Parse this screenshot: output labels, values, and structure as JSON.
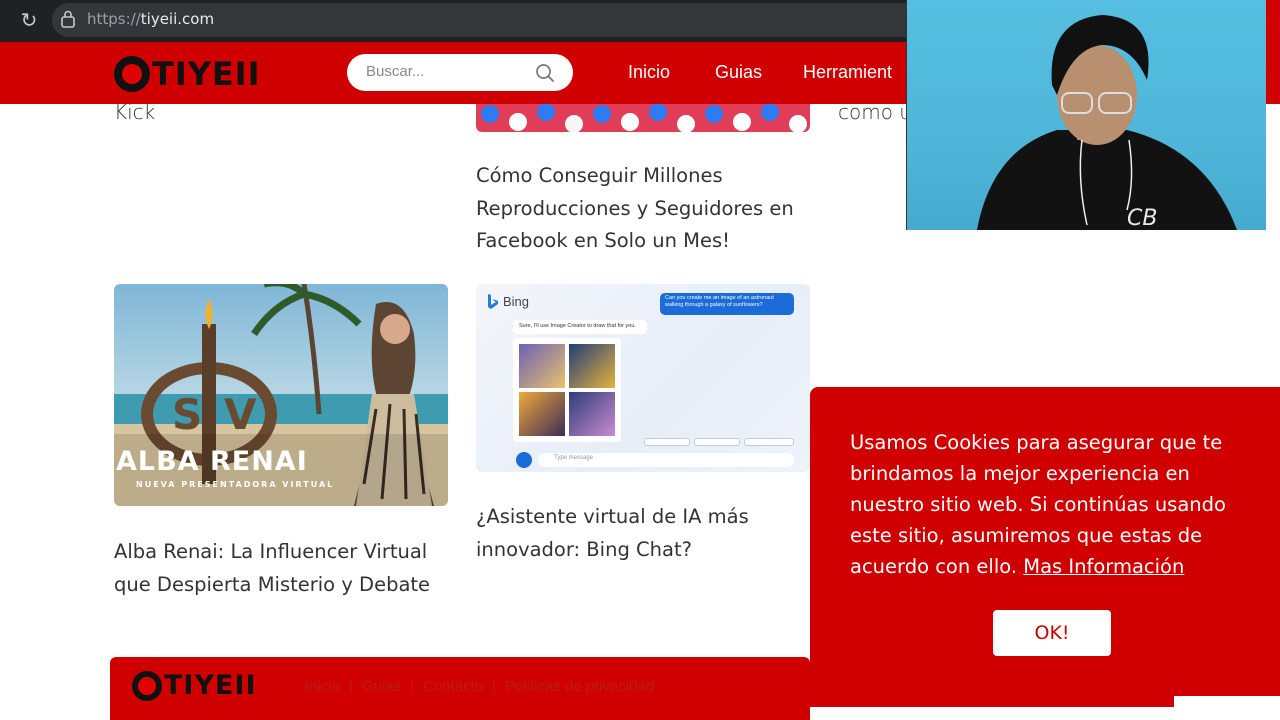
{
  "browser": {
    "url_protocol": "https://",
    "url_domain": "tiyeii.com",
    "reload_icon": "reload-icon",
    "lock_icon": "site-info-icon"
  },
  "header": {
    "logo_text": "TIYEII",
    "search_placeholder": "Buscar...",
    "nav": [
      "Inicio",
      "Guias",
      "Herramient"
    ],
    "right_snippet": "como u"
  },
  "articles": {
    "col1_snippet": "Kick",
    "facebook_title": "Cómo Conseguir Millones Reproducciones y Seguidores en Facebook en Solo un Mes!",
    "alba_title": "Alba Renai: La Influencer Virtual que Despierta Misterio y Debate",
    "alba_thumb_heading": "ALBA RENAI",
    "alba_thumb_sub": "NUEVA PRESENTADORA VIRTUAL",
    "alba_thumb_logo": "SV",
    "bing_title": "¿Asistente virtual de IA más innovador: Bing Chat?",
    "bing_thumb_brand": "Bing",
    "bing_thumb_user_msg": "Can you create me an image of an astronaut walking through a galaxy of sunflowers?",
    "bing_thumb_reply": "Sure, I'll use Image Creator to draw that for you.",
    "bing_thumb_input": "Type message"
  },
  "cookie": {
    "text": "Usamos Cookies para asegurar que te brindamos la mejor experiencia en nuestro sitio web. Si continúas usando este sitio, asumiremos que estas de acuerdo con ello.",
    "link": "Mas Información",
    "button": "OK!"
  },
  "footer": {
    "logo_text": "TIYEII",
    "links": [
      "Inicio",
      "Guias",
      "Contacto",
      "Politicas de privacidad"
    ]
  },
  "colors": {
    "brand_red": "#d10000",
    "text_dark": "#333333",
    "browser_bg": "#202124"
  }
}
